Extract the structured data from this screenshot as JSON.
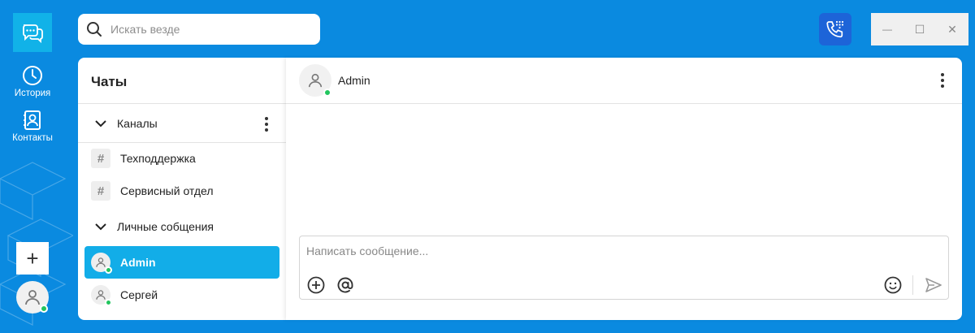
{
  "rail": {
    "history_label": "История",
    "contacts_label": "Контакты",
    "add_label": "+"
  },
  "search": {
    "placeholder": "Искать везде"
  },
  "window": {
    "minimize": "—",
    "maximize": "☐",
    "close": "✕"
  },
  "chats": {
    "title": "Чаты",
    "channels_section": "Каналы",
    "channels": [
      {
        "name": "Техподдержка"
      },
      {
        "name": "Сервисный отдел"
      }
    ],
    "dm_section": "Личные собщения",
    "direct_messages": [
      {
        "name": "Admin",
        "active": true,
        "online": true
      },
      {
        "name": "Сергей",
        "active": false,
        "online": true
      }
    ]
  },
  "conversation": {
    "contact_name": "Admin",
    "composer_placeholder": "Написать сообщение..."
  },
  "colors": {
    "background": "#0a8ae0",
    "accent": "#12ade8",
    "online": "#22c55e",
    "call_button": "#1d64d8"
  }
}
